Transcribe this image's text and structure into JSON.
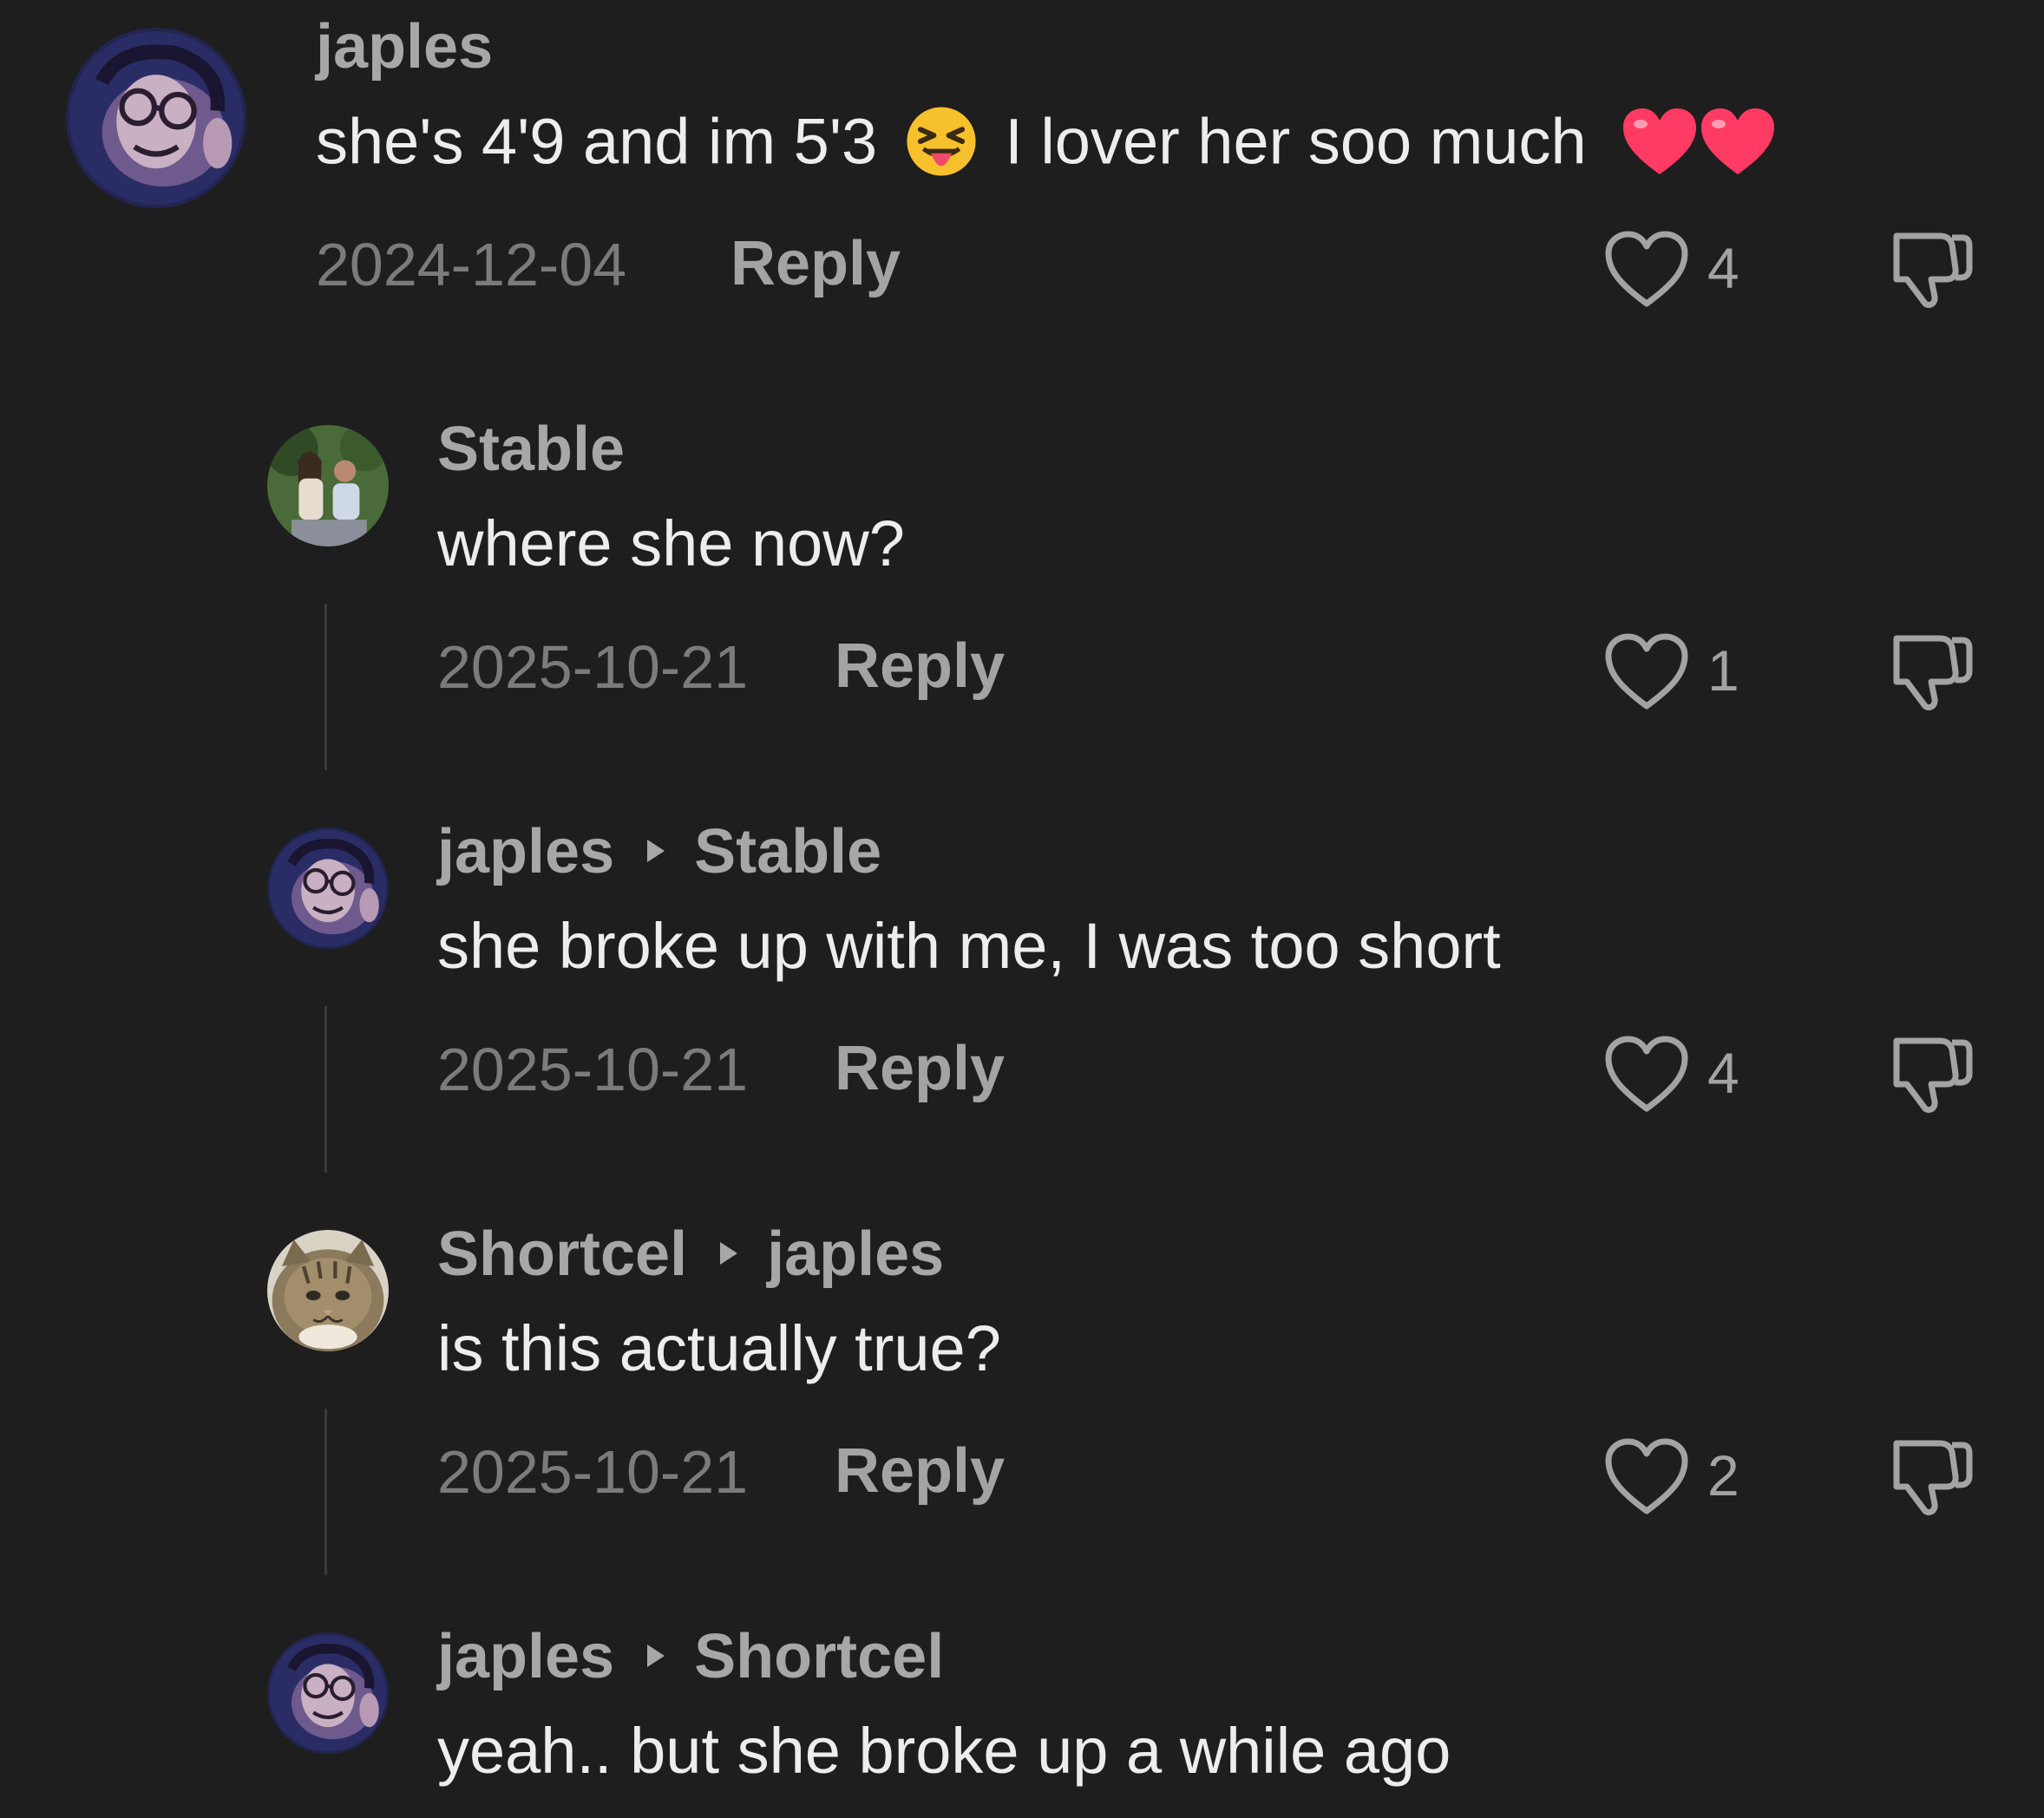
{
  "colors": {
    "background": "#1e1e1e",
    "username": "#a7a7a7",
    "body_text": "#ededed",
    "date": "#7b7b7b",
    "action": "#a3a3a3",
    "heart_emoji": "#ff3b63"
  },
  "comments": [
    {
      "avatar": "avatar-japles",
      "author": "japles",
      "reply_to": "",
      "text_before_emoji": "she's 4'9 and im 5'3",
      "emoji_1": "squinting-tongue-face-emoji",
      "text_after_emoji": "I lover her soo much",
      "emoji_2": "two-red-hearts-emoji",
      "date": "2024-12-04",
      "reply_label": "Reply",
      "likes": "4"
    },
    {
      "avatar": "avatar-stable",
      "author": "Stable",
      "reply_to": "",
      "text": "where she now?",
      "date": "2025-10-21",
      "reply_label": "Reply",
      "likes": "1"
    },
    {
      "avatar": "avatar-japles",
      "author": "japles",
      "reply_to": "Stable",
      "text": "she broke up with me, I was too short",
      "date": "2025-10-21",
      "reply_label": "Reply",
      "likes": "4"
    },
    {
      "avatar": "avatar-shortcel-cat",
      "author": "Shortcel",
      "reply_to": "japles",
      "text": "is this actually true?",
      "date": "2025-10-21",
      "reply_label": "Reply",
      "likes": "2"
    },
    {
      "avatar": "avatar-japles",
      "author": "japles",
      "reply_to": "Shortcel",
      "text": "yeah.. but she broke up a while ago"
    }
  ],
  "icons": {
    "like": "heart-outline-icon",
    "dislike": "thumbs-down-icon",
    "reply_arrow": "triangle-right-icon"
  }
}
